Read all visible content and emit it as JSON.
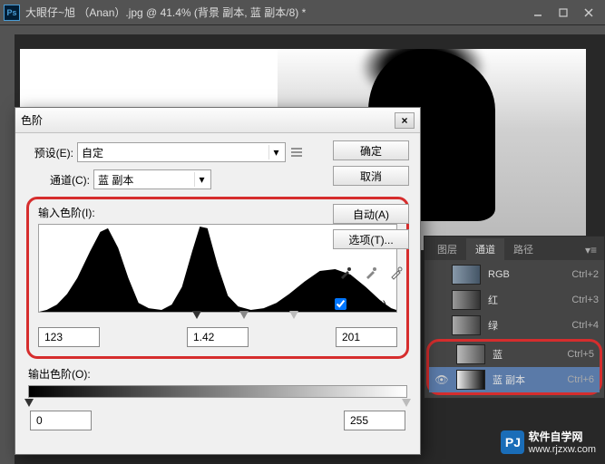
{
  "titlebar": {
    "app_icon": "Ps",
    "title": "大眼仔~旭 （Anan）.jpg @ 41.4% (背景 副本, 蓝 副本/8) *"
  },
  "dialog": {
    "title": "色阶",
    "preset_label": "预设(E):",
    "preset_value": "自定",
    "channel_label": "通道(C):",
    "channel_value": "蓝 副本",
    "input_label": "输入色阶(I):",
    "input_black": "123",
    "input_gamma": "1.42",
    "input_white": "201",
    "output_label": "输出色阶(O):",
    "output_black": "0",
    "output_white": "255",
    "buttons": {
      "ok": "确定",
      "cancel": "取消",
      "auto": "自动(A)",
      "options": "选项(T)..."
    },
    "preview_label": "预览(P)"
  },
  "panel": {
    "tabs": [
      "图层",
      "通道",
      "路径"
    ],
    "active_tab_index": 1,
    "channels": [
      {
        "name": "RGB",
        "shortcut": "Ctrl+2",
        "eye": false
      },
      {
        "name": "红",
        "shortcut": "Ctrl+3",
        "eye": false
      },
      {
        "name": "绿",
        "shortcut": "Ctrl+4",
        "eye": false
      },
      {
        "name": "蓝",
        "shortcut": "Ctrl+5",
        "eye": false
      },
      {
        "name": "蓝 副本",
        "shortcut": "Ctrl+6",
        "eye": true
      }
    ]
  },
  "watermark": {
    "text": "软件自学网",
    "url": "www.rjzxw.com"
  }
}
